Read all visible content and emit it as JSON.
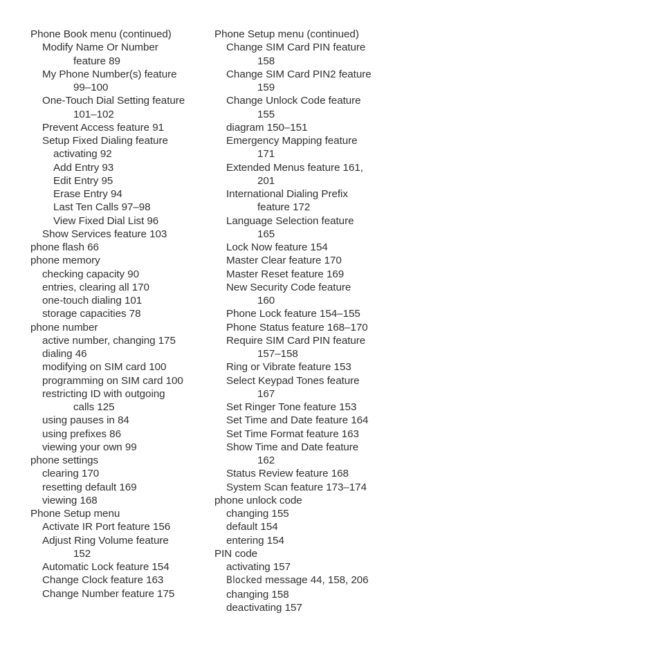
{
  "document": {
    "type": "book-index-page",
    "background_color": "#ffffff",
    "text_color": "#2f2f2f",
    "columns": 2
  },
  "left_column": {
    "heading": "Phone Book menu (continued)",
    "entries": [
      {
        "text": "Modify Name Or Number",
        "level": 1,
        "pages": ""
      },
      {
        "text": "feature  89",
        "level": 1,
        "continuation": true
      },
      {
        "text": "My Phone Number(s) feature",
        "level": 1
      },
      {
        "text": "99–100",
        "level": 1,
        "continuation": true
      },
      {
        "text": "One-Touch Dial Setting feature",
        "level": 1
      },
      {
        "text": "101–102",
        "level": 1,
        "continuation": true
      },
      {
        "text": "Prevent Access feature  91",
        "level": 1
      },
      {
        "text": "Setup Fixed Dialing feature",
        "level": 1
      },
      {
        "text": "activating  92",
        "level": 2
      },
      {
        "text": "Add Entry  93",
        "level": 2
      },
      {
        "text": "Edit Entry  95",
        "level": 2
      },
      {
        "text": "Erase Entry  94",
        "level": 2
      },
      {
        "text": "Last Ten Calls  97–98",
        "level": 2
      },
      {
        "text": "View Fixed Dial List  96",
        "level": 2
      },
      {
        "text": "Show Services feature  103",
        "level": 1
      },
      {
        "text": "phone flash  66",
        "level": 0
      },
      {
        "text": "phone memory",
        "level": 0
      },
      {
        "text": "checking capacity  90",
        "level": 1
      },
      {
        "text": "entries, clearing all  170",
        "level": 1
      },
      {
        "text": "one-touch dialing  101",
        "level": 1
      },
      {
        "text": "storage capacities  78",
        "level": 1
      },
      {
        "text": "phone number",
        "level": 0
      },
      {
        "text": "active number, changing  175",
        "level": 1
      },
      {
        "text": "dialing  46",
        "level": 1
      },
      {
        "text": "modifying on SIM card  100",
        "level": 1
      },
      {
        "text": "programming on SIM card  100",
        "level": 1
      },
      {
        "text": "restricting ID with outgoing",
        "level": 1
      },
      {
        "text": "calls  125",
        "level": 1,
        "continuation": true
      },
      {
        "text": "using pauses in  84",
        "level": 1
      },
      {
        "text": "using prefixes  86",
        "level": 1
      },
      {
        "text": "viewing your own  99",
        "level": 1
      },
      {
        "text": "phone settings",
        "level": 0
      },
      {
        "text": "clearing  170",
        "level": 1
      },
      {
        "text": "resetting default  169",
        "level": 1
      },
      {
        "text": "viewing  168",
        "level": 1
      },
      {
        "text": "Phone Setup menu",
        "level": 0
      },
      {
        "text": "Activate IR Port feature  156",
        "level": 1
      },
      {
        "text": "Adjust Ring Volume feature",
        "level": 1
      },
      {
        "text": "152",
        "level": 1,
        "continuation": true
      },
      {
        "text": "Automatic Lock feature  154",
        "level": 1
      },
      {
        "text": "Change Clock feature  163",
        "level": 1
      },
      {
        "text": "Change Number feature  175",
        "level": 1
      }
    ]
  },
  "right_column": {
    "heading": "Phone Setup menu (continued)",
    "entries": [
      {
        "text": "Change SIM Card PIN feature",
        "level": 1
      },
      {
        "text": "158",
        "level": 1,
        "continuation": true
      },
      {
        "text": "Change SIM Card PIN2 feature",
        "level": 1
      },
      {
        "text": "159",
        "level": 1,
        "continuation": true
      },
      {
        "text": "Change Unlock Code feature",
        "level": 1
      },
      {
        "text": "155",
        "level": 1,
        "continuation": true
      },
      {
        "text": "diagram  150–151",
        "level": 1
      },
      {
        "text": "Emergency Mapping feature",
        "level": 1
      },
      {
        "text": "171",
        "level": 1,
        "continuation": true
      },
      {
        "text": "Extended Menus feature  161,",
        "level": 1
      },
      {
        "text": "201",
        "level": 1,
        "continuation": true
      },
      {
        "text": "International Dialing Prefix",
        "level": 1
      },
      {
        "text": "feature  172",
        "level": 1,
        "continuation": true
      },
      {
        "text": "Language Selection feature",
        "level": 1
      },
      {
        "text": "165",
        "level": 1,
        "continuation": true
      },
      {
        "text": "Lock Now feature  154",
        "level": 1
      },
      {
        "text": "Master Clear feature  170",
        "level": 1
      },
      {
        "text": "Master Reset feature  169",
        "level": 1
      },
      {
        "text": "New Security Code feature",
        "level": 1
      },
      {
        "text": "160",
        "level": 1,
        "continuation": true
      },
      {
        "text": "Phone Lock feature  154–155",
        "level": 1
      },
      {
        "text": "Phone Status feature  168–170",
        "level": 1
      },
      {
        "text": "Require SIM Card PIN feature",
        "level": 1
      },
      {
        "text": "157–158",
        "level": 1,
        "continuation": true
      },
      {
        "text": "Ring or Vibrate feature  153",
        "level": 1
      },
      {
        "text": "Select Keypad Tones feature",
        "level": 1
      },
      {
        "text": "167",
        "level": 1,
        "continuation": true
      },
      {
        "text": "Set Ringer Tone feature  153",
        "level": 1
      },
      {
        "text": "Set Time and Date feature  164",
        "level": 1
      },
      {
        "text": "Set Time Format feature  163",
        "level": 1
      },
      {
        "text": "Show Time and Date feature",
        "level": 1
      },
      {
        "text": "162",
        "level": 1,
        "continuation": true
      },
      {
        "text": "Status Review feature  168",
        "level": 1
      },
      {
        "text": "System Scan feature  173–174",
        "level": 1
      },
      {
        "text": "phone unlock code",
        "level": 0
      },
      {
        "text": "changing  155",
        "level": 1
      },
      {
        "text": "default  154",
        "level": 1
      },
      {
        "text": "entering  154",
        "level": 1
      },
      {
        "text": "PIN code",
        "level": 0
      },
      {
        "text": "activating  157",
        "level": 1
      },
      {
        "text": "Blocked message  44, 158, 206",
        "level": 1,
        "device_word": "Blocked",
        "rest": " message  44, 158, 206"
      },
      {
        "text": "changing  158",
        "level": 1
      },
      {
        "text": "deactivating  157",
        "level": 1
      }
    ]
  }
}
